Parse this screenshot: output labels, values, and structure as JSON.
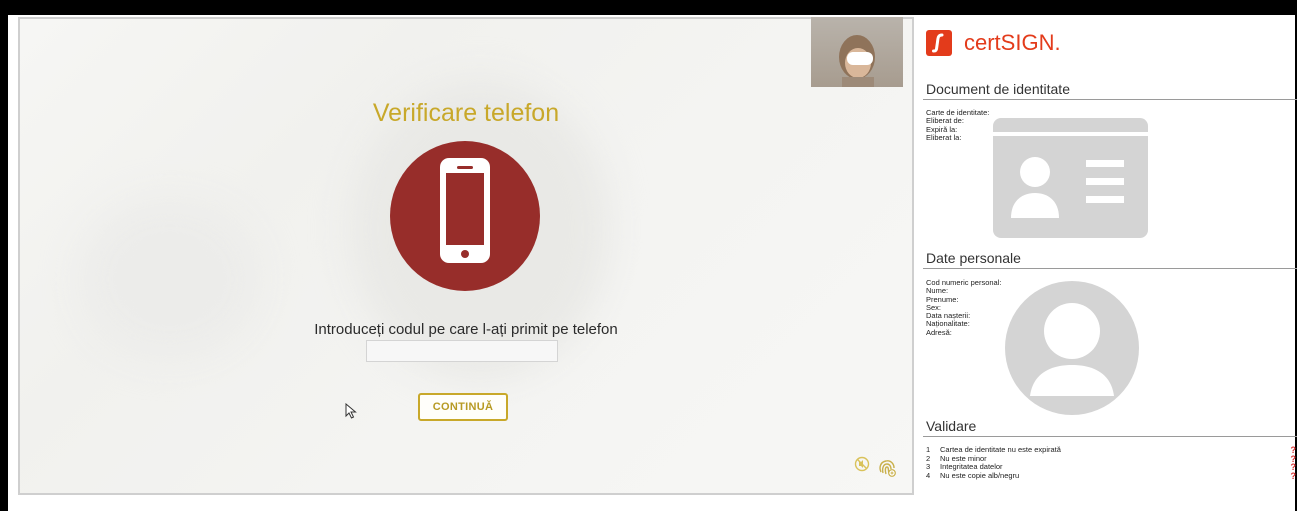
{
  "main": {
    "title": "Verificare telefon",
    "phone_icon": "smartphone-icon",
    "instruction": "Introduceți codul pe care l-ați primit pe telefon",
    "code_input": {
      "value": "",
      "placeholder": ""
    },
    "continue_label": "CONTINUĂ",
    "corner_icons": [
      "no-sound-icon",
      "fingerprint-icon"
    ],
    "accent_color": "#c8a82a",
    "phone_circle_color": "#972d2a"
  },
  "brand": {
    "name": "certSIGN",
    "color": "#e33b1b",
    "logo_icon": "certsign-logo-icon"
  },
  "document": {
    "title": "Document de identitate",
    "fields": [
      "Carte de identitate:",
      "Eliberat de:",
      "Expiră la:",
      "Eliberat la:"
    ],
    "card_icon": "id-card-icon"
  },
  "personal": {
    "title": "Date personale",
    "fields": [
      "Cod numeric personal:",
      "Nume:",
      "Prenume:",
      "Sex:",
      "Data nașterii:",
      "Naționalitate:",
      "Adresă:"
    ],
    "avatar_icon": "person-avatar-icon"
  },
  "validation": {
    "title": "Validare",
    "items": [
      {
        "num": "1",
        "text": "Cartea de identitate nu este expirată",
        "status": "?"
      },
      {
        "num": "2",
        "text": "Nu este minor",
        "status": "?"
      },
      {
        "num": "3",
        "text": "Integritatea datelor",
        "status": "?"
      },
      {
        "num": "4",
        "text": "Nu este copie alb/negru",
        "status": "?"
      }
    ],
    "status_color": "#d62f2f"
  }
}
